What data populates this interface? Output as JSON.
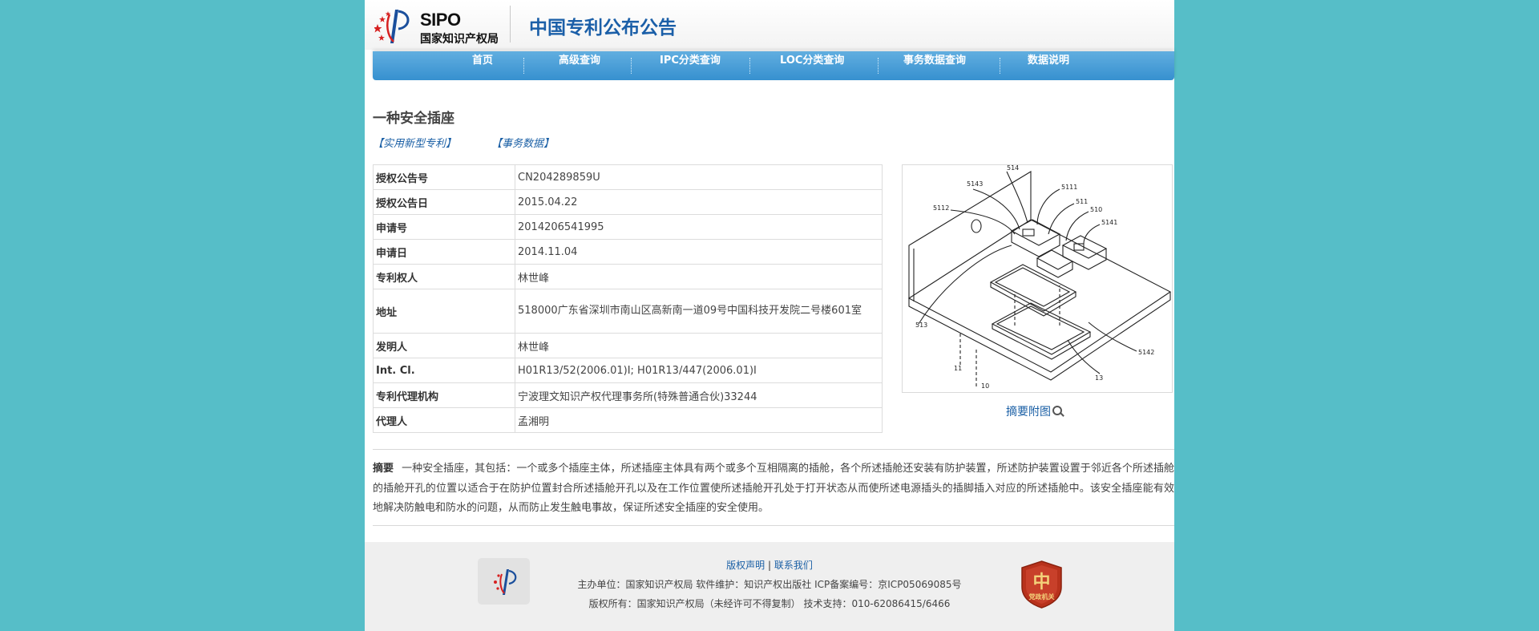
{
  "header": {
    "logo_text": "SIPO",
    "logo_subtext": "国家知识产权局",
    "site_title": "中国专利公布公告"
  },
  "nav": {
    "items": [
      {
        "label": "首页"
      },
      {
        "label": "高级查询"
      },
      {
        "label": "IPC分类查询"
      },
      {
        "label": "LOC分类查询"
      },
      {
        "label": "事务数据查询"
      },
      {
        "label": "数据说明"
      }
    ]
  },
  "patent": {
    "title": "一种安全插座",
    "type_link": "【实用新型专利】",
    "transaction_link": "【事务数据】",
    "fields": [
      {
        "label": "授权公告号",
        "value": "CN204289859U"
      },
      {
        "label": "授权公告日",
        "value": "2015.04.22"
      },
      {
        "label": "申请号",
        "value": "2014206541995"
      },
      {
        "label": "申请日",
        "value": "2014.11.04"
      },
      {
        "label": "专利权人",
        "value": "林世峰"
      },
      {
        "label": "地址",
        "value": "518000广东省深圳市南山区高新南一道09号中国科技开发院二号楼601室"
      },
      {
        "label": "发明人",
        "value": "林世峰"
      },
      {
        "label": "Int. Cl.",
        "value": "H01R13/52(2006.01)I;  H01R13/447(2006.01)I"
      },
      {
        "label": "专利代理机构",
        "value": "宁波理文知识产权代理事务所(特殊普通合伙)33244"
      },
      {
        "label": "代理人",
        "value": "孟湘明"
      }
    ],
    "abstract_image_link": "摘要附图",
    "figure_labels": [
      "514",
      "5143",
      "5111",
      "511",
      "510",
      "5112",
      "5141",
      "513",
      "11",
      "10",
      "13",
      "5142"
    ],
    "abstract_label": "摘要",
    "abstract_text": "一种安全插座，其包括：一个或多个插座主体，所述插座主体具有两个或多个互相隔离的插舱，各个所述插舱还安装有防护装置，所述防护装置设置于邻近各个所述插舱的插舱开孔的位置以适合于在防护位置封合所述插舱开孔以及在工作位置使所述插舱开孔处于打开状态从而使所述电源插头的插脚插入对应的所述插舱中。该安全插座能有效地解决防触电和防水的问题，从而防止发生触电事故，保证所述安全插座的安全使用。"
  },
  "footer": {
    "copyright_link": "版权声明",
    "separator": "|",
    "contact_link": "联系我们",
    "line1": "主办单位：国家知识产权局    软件维护：知识产权出版社    ICP备案编号：京ICP05069085号",
    "line2": "版权所有：国家知识产权局（未经许可不得复制）   技术支持：010-62086415/6466",
    "badge_text": "党政机关"
  },
  "colors": {
    "background": "#56bec8",
    "nav": "#3690cf",
    "link": "#1a5fa5",
    "title_blue": "#1b5fa8"
  }
}
